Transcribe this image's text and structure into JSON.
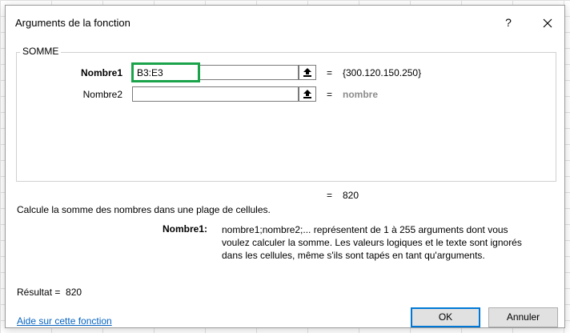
{
  "dialog": {
    "title": "Arguments de la fonction",
    "help_symbol": "?",
    "function_name": "SOMME",
    "arguments": [
      {
        "label": "Nombre1",
        "value": "B3:E3",
        "result": "{300.120.150.250}"
      },
      {
        "label": "Nombre2",
        "value": "",
        "result": "nombre"
      }
    ],
    "equals": "=",
    "total_value": "820",
    "description": "Calcule la somme des nombres dans une plage de cellules.",
    "arg_help_label": "Nombre1:",
    "arg_help_lines": [
      "nombre1;nombre2;... représentent de 1 à 255 arguments dont vous",
      "voulez calculer la somme. Les valeurs logiques et le texte sont ignorés",
      "dans les cellules, même s'ils sont tapés en tant qu'arguments."
    ],
    "result_label": "Résultat =",
    "result_value": "820",
    "help_link": "Aide sur cette fonction",
    "ok_label": "OK",
    "cancel_label": "Annuler"
  },
  "colors": {
    "focus_border": "#1aa34a",
    "link": "#0563c1",
    "default_button_border": "#0078d7"
  }
}
